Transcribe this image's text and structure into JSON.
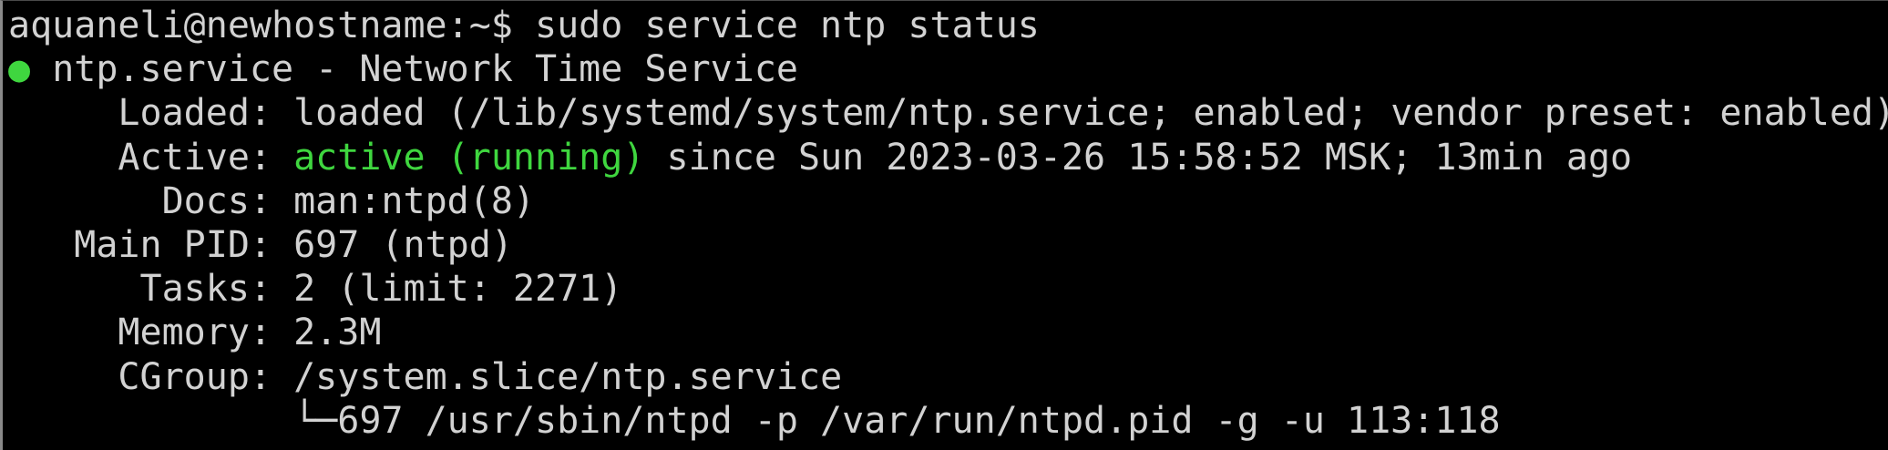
{
  "colors": {
    "background": "#000000",
    "foreground": "#d2d2d2",
    "active_green": "#3fd63f"
  },
  "prompt": {
    "user_host": "aquaneli@newhostname:~$",
    "command": "sudo service ntp status"
  },
  "status": {
    "bullet": "●",
    "unit": "ntp.service - Network Time Service",
    "loaded_label": "Loaded:",
    "loaded_value": "loaded (/lib/systemd/system/ntp.service; enabled; vendor preset: enabled)",
    "active_label": "Active:",
    "active_state": "active (running)",
    "active_since": "since Sun 2023-03-26 15:58:52 MSK; 13min ago",
    "docs_label": "Docs:",
    "docs_value": "man:ntpd(8)",
    "mainpid_label": "Main PID:",
    "mainpid_value": "697 (ntpd)",
    "tasks_label": "Tasks:",
    "tasks_value": "2 (limit: 2271)",
    "memory_label": "Memory:",
    "memory_value": "2.3M",
    "cgroup_label": "CGroup:",
    "cgroup_value": "/system.slice/ntp.service",
    "process_tree": "└─697 /usr/sbin/ntpd -p /var/run/ntpd.pid -g -u 113:118"
  }
}
